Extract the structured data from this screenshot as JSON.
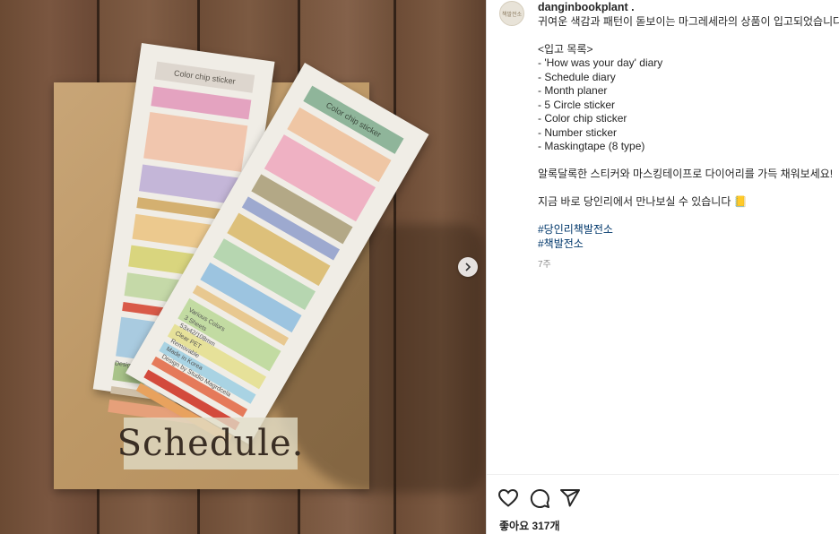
{
  "photo": {
    "envelope_label": "Color chip sticker",
    "envelope1_chip_colors": [
      "#e4a3c0",
      "#f1c6ae",
      "#c4b6d8",
      "#d4b070",
      "#ecc98e",
      "#d9d57e",
      "#c5d9a8",
      "#d95a48",
      "#a9cbe0",
      "#a8c389",
      "#cfc0a8",
      "#e6a07a"
    ],
    "envelope2_chip_colors": [
      "#8fb59a",
      "#efc6a4",
      "#efb1c3",
      "#b3a886",
      "#9da9cf",
      "#ddc07a",
      "#b6d6b0",
      "#9cc4e0",
      "#e8c890",
      "#c2dba2",
      "#e6e199",
      "#a9d3e3",
      "#e57a5a",
      "#d34a3c",
      "#e8a25e"
    ],
    "envelope2_notes": [
      "Various Colors",
      "3 Sheets",
      "53x42/108mm",
      "Clear PET",
      "Removable",
      "Made in Korea",
      "Design by Studio Magrdcela"
    ],
    "envelope1_note": "Design by",
    "notebook_title": "Schedule."
  },
  "post": {
    "avatar_text": "책발전소",
    "username": "danginbookplant .",
    "caption_lines": [
      "귀여운 색감과 패턴이 돋보이는 마그레세라의 상품이 입고되었습니다🎨",
      "",
      "<입고 목록>",
      "- 'How was your day' diary",
      "- Schedule diary",
      "- Month planer",
      "- 5 Circle sticker",
      "- Color chip sticker",
      "- Number sticker",
      "- Maskingtape (8 type)",
      "",
      "알록달록한 스티커와 마스킹테이프로 다이어리를 가득 채워보세요!",
      "",
      "지금 바로 당인리에서 만나보실 수 있습니다 📒",
      ""
    ],
    "hashtags": [
      "#당인리책발전소",
      "#책발전소"
    ],
    "time_ago": "7주",
    "likes": "좋아요 317개"
  },
  "icons": {
    "like": "heart-icon",
    "comment": "comment-icon",
    "share": "share-icon",
    "next": "chevron-right-icon"
  }
}
